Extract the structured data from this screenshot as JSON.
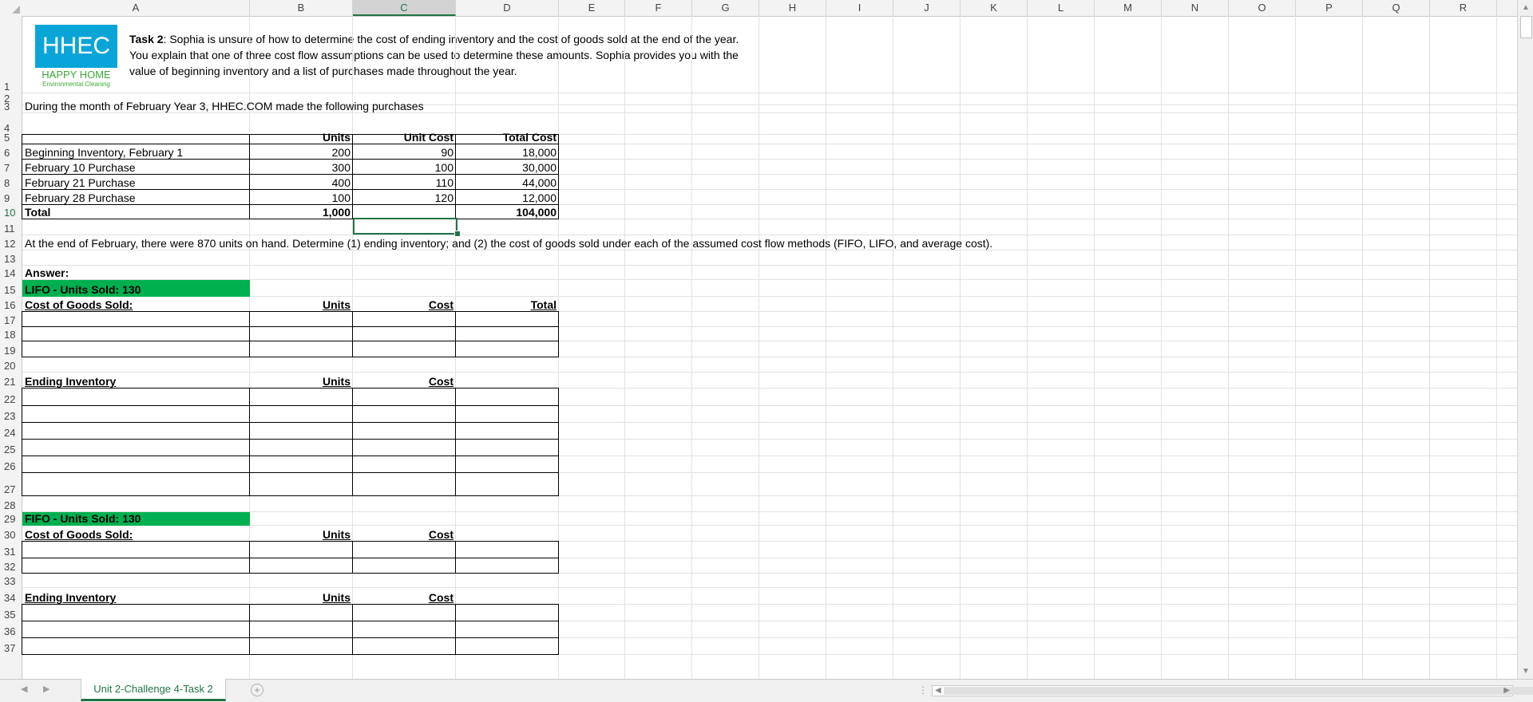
{
  "columns": [
    "A",
    "B",
    "C",
    "D",
    "E",
    "F",
    "G",
    "H",
    "I",
    "J",
    "K",
    "L",
    "M",
    "N",
    "O",
    "P",
    "Q",
    "R"
  ],
  "selected_column": "C",
  "rows": [
    "1",
    "2",
    "3",
    "4",
    "5",
    "6",
    "7",
    "8",
    "9",
    "10",
    "11",
    "12",
    "13",
    "14",
    "15",
    "16",
    "17",
    "18",
    "19",
    "20",
    "21",
    "22",
    "23",
    "24",
    "25",
    "26",
    "27",
    "28",
    "29",
    "30",
    "31",
    "32",
    "33",
    "34",
    "35",
    "36",
    "37"
  ],
  "selected_row": "10",
  "logo": {
    "mark": "HHEC",
    "line1": "HAPPY HOME",
    "line2": "Environmental Cleaning"
  },
  "task": {
    "label": "Task 2",
    "text": ": Sophia is unsure of how to determine the cost of ending inventory and the cost of goods sold at the end of the year. You explain that one of three cost flow assumptions can be used to determine these amounts. Sophia provides you with the value of beginning inventory and a list of purchases made throughout the year."
  },
  "row3": "During the month of February  Year 3, HHEC.COM made the following purchases",
  "table": {
    "headers": [
      "Units",
      "Unit Cost",
      "Total Cost"
    ],
    "rows": [
      {
        "label": "Beginning Inventory, February 1",
        "units": "200",
        "cost": "90",
        "total": "18,000"
      },
      {
        "label": "February 10 Purchase",
        "units": "300",
        "cost": "100",
        "total": "30,000"
      },
      {
        "label": "February 21 Purchase",
        "units": "400",
        "cost": "110",
        "total": "44,000"
      },
      {
        "label": "February 28 Purchase",
        "units": "100",
        "cost": "120",
        "total": "12,000"
      }
    ],
    "total": {
      "label": "Total",
      "units": "1,000",
      "cost": "",
      "total": "104,000"
    }
  },
  "row12": "At the end of February, there were 870 units on hand.  Determine (1) ending inventory; and (2) the cost of goods sold under each of the assumed cost flow methods (FIFO, LIFO, and average cost).",
  "answer_label": "Answer:",
  "lifo": {
    "banner": "LIFO - Units Sold:  130",
    "cogs": {
      "title": "Cost of Goods  Sold:",
      "units": "Units",
      "cost": "Cost",
      "total": "Total"
    },
    "ending": {
      "title": "Ending Inventory",
      "units": "Units",
      "cost": "Cost"
    }
  },
  "fifo": {
    "banner": "FIFO - Units Sold:  130",
    "cogs": {
      "title": "Cost of Goods  Sold:",
      "units": "Units",
      "cost": "Cost"
    },
    "ending": {
      "title": "Ending Inventory",
      "units": "Units",
      "cost": "Cost"
    }
  },
  "sheet_tab": "Unit 2-Challenge 4-Task 2",
  "colors": {
    "accent": "#217346",
    "banner": "#00b050",
    "logo": "#0aa5d8",
    "logo_text": "#3aaa35"
  }
}
